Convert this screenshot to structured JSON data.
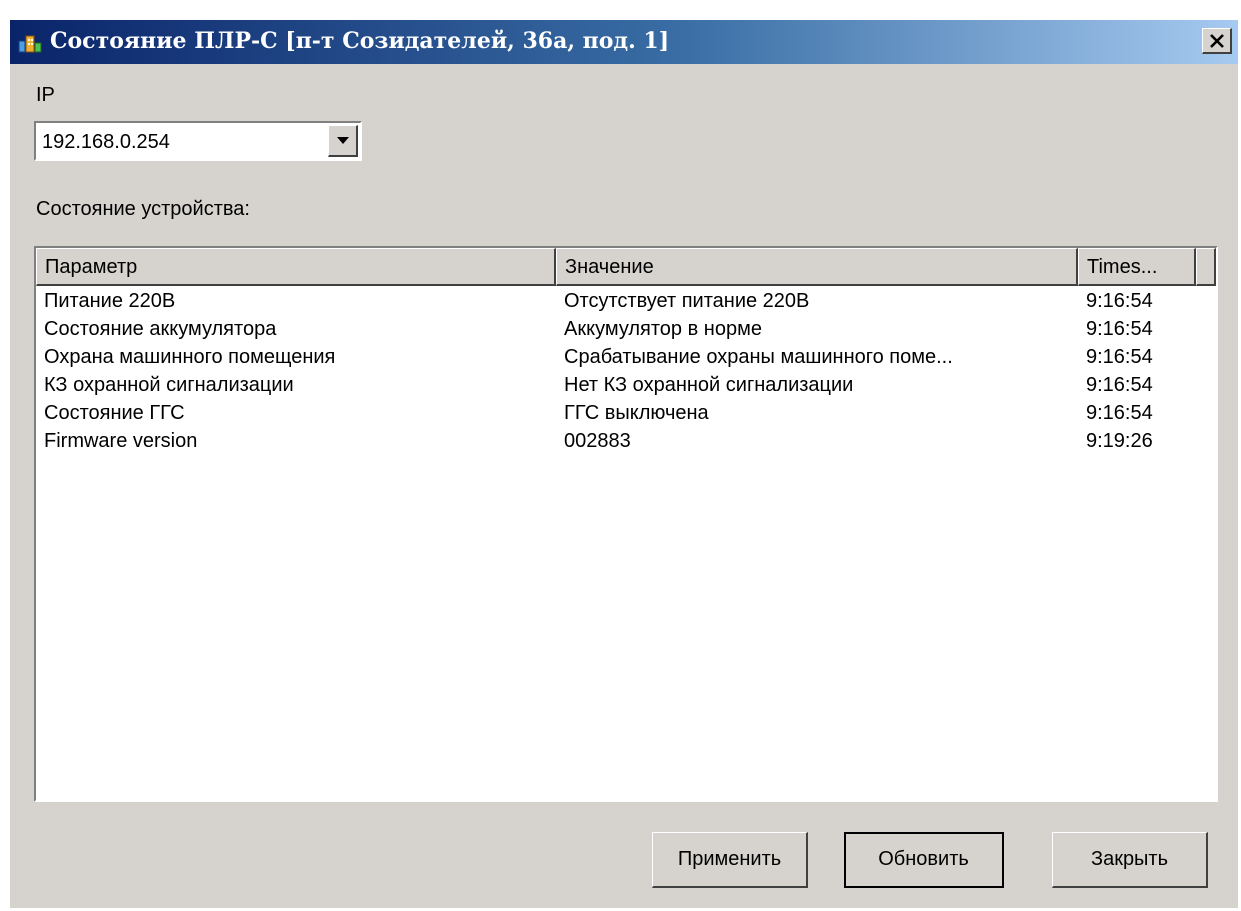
{
  "window": {
    "title": "Состояние ПЛР-С [п-т Созидателей, 36а, под. 1]",
    "app_icon": "network-building-icon",
    "close_icon": "close-x-icon"
  },
  "ip": {
    "label": "IP",
    "selected": "192.168.0.254",
    "dropdown_icon": "triangle-down-icon"
  },
  "device_status": {
    "label": "Состояние устройства:",
    "columns": {
      "param": "Параметр",
      "value": "Значение",
      "time": "Times..."
    },
    "rows": [
      {
        "param": "Питание 220В",
        "value": "Отсутствует питание 220В",
        "time": "9:16:54"
      },
      {
        "param": "Состояние аккумулятора",
        "value": "Аккумулятор в норме",
        "time": "9:16:54"
      },
      {
        "param": "Охрана машинного помещения",
        "value": "Срабатывание охраны машинного поме...",
        "time": "9:16:54"
      },
      {
        "param": "КЗ охранной сигнализации",
        "value": "Нет КЗ охранной сигнализации",
        "time": "9:16:54"
      },
      {
        "param": "Состояние ГГС",
        "value": "ГГС выключена",
        "time": "9:16:54"
      },
      {
        "param": "Firmware version",
        "value": "002883",
        "time": "9:19:26"
      }
    ]
  },
  "buttons": {
    "apply": "Применить",
    "refresh": "Обновить",
    "close": "Закрыть"
  }
}
